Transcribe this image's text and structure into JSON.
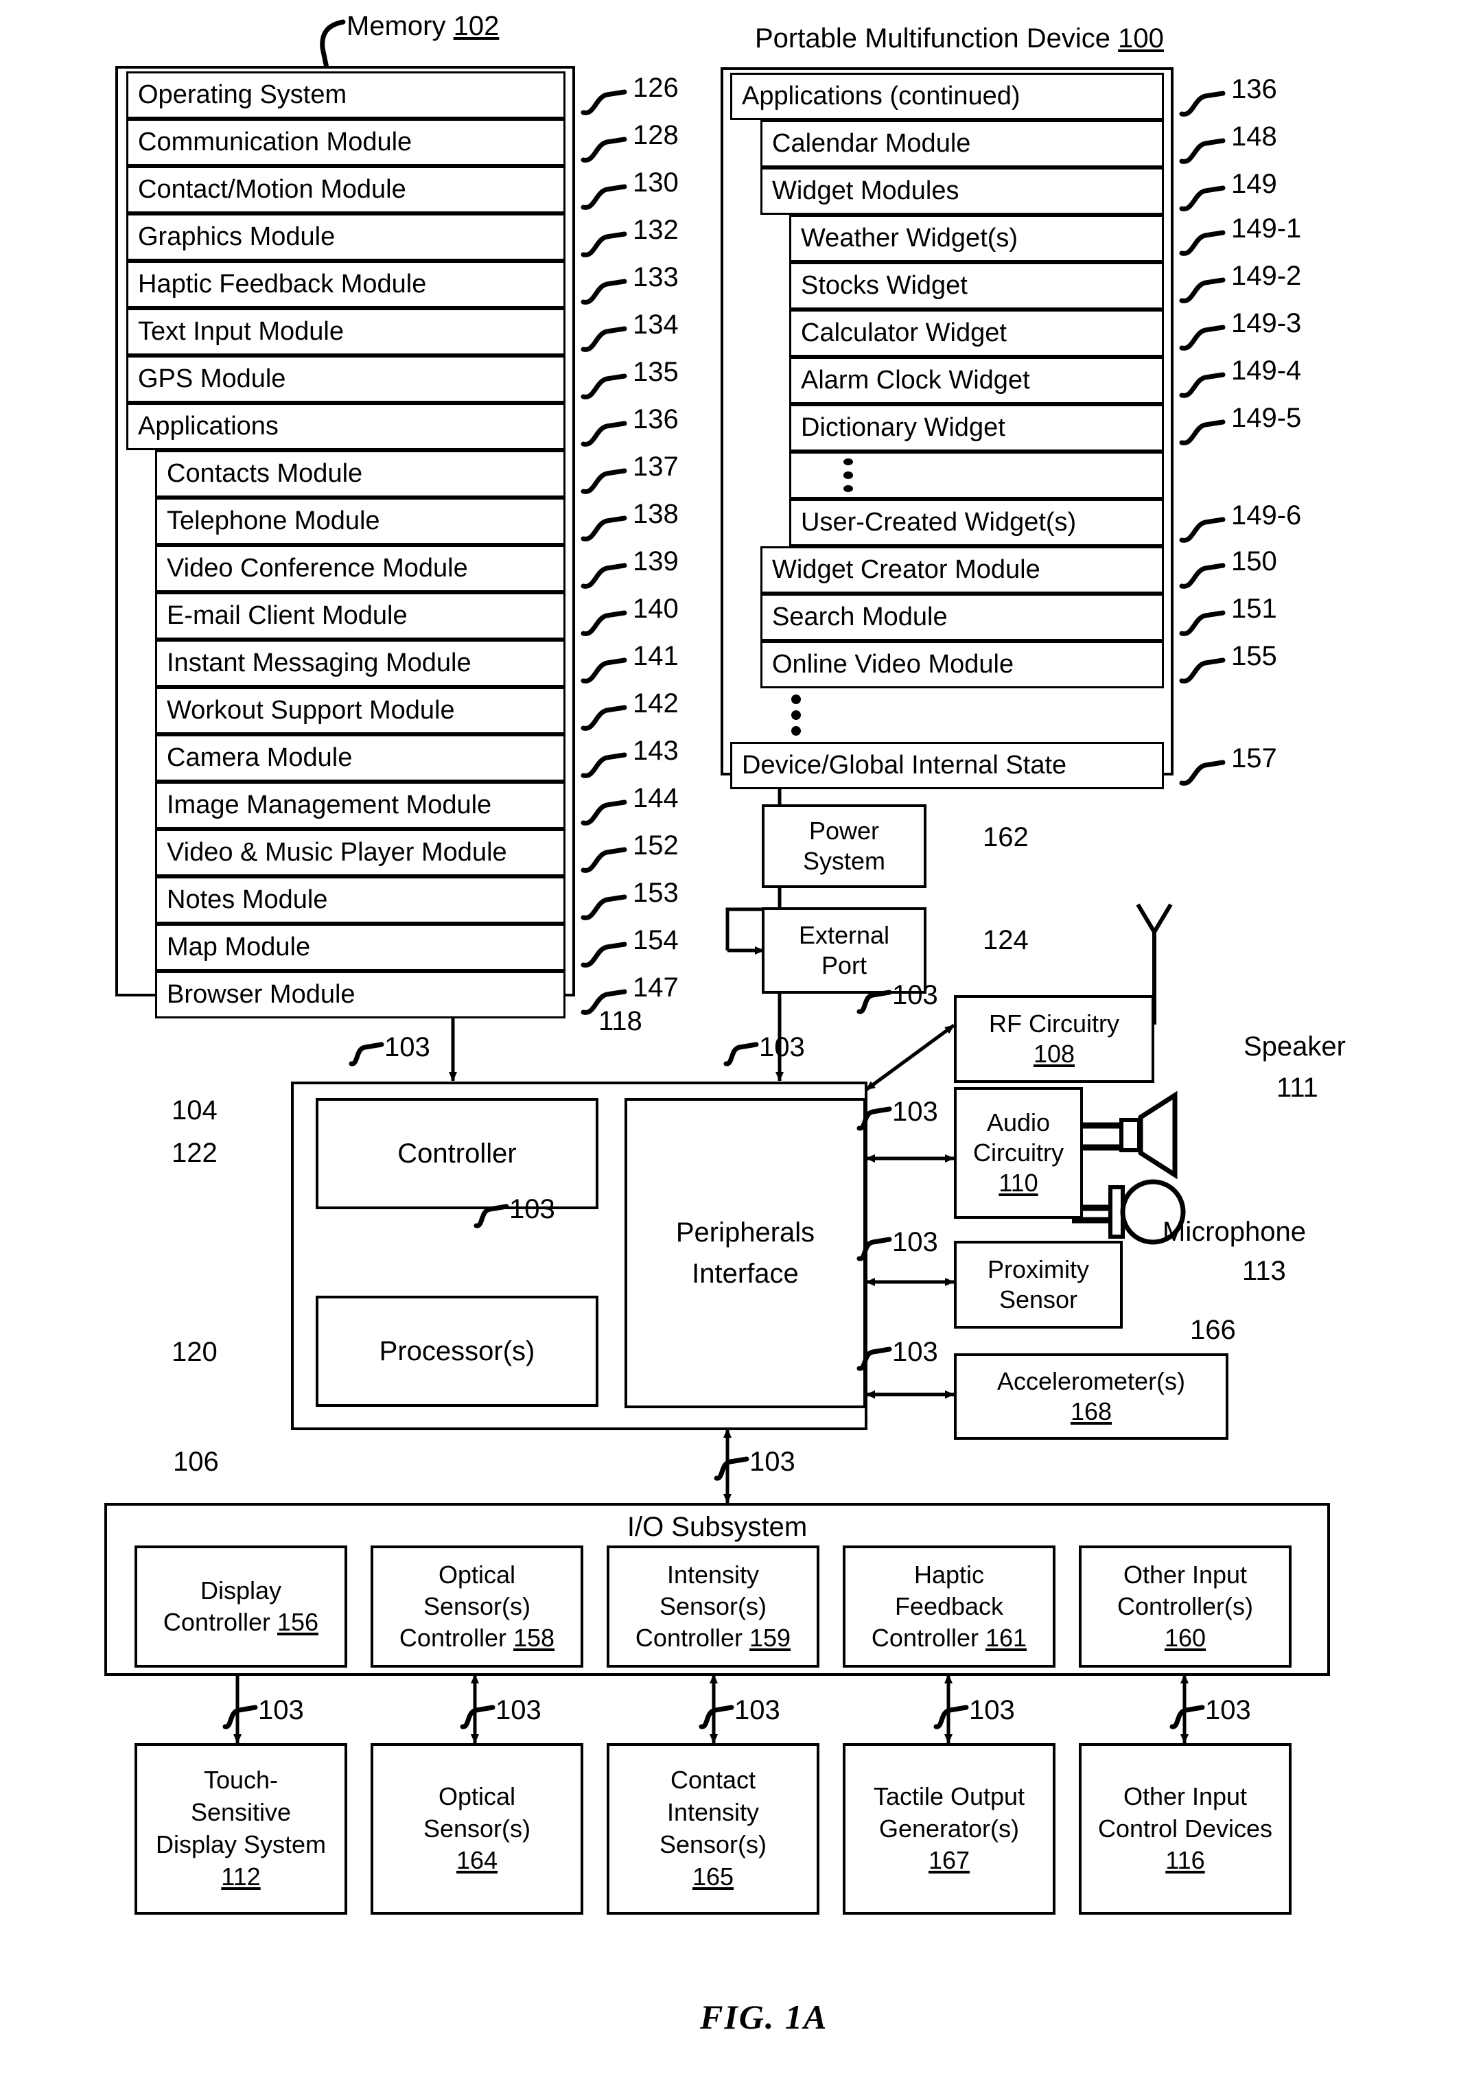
{
  "figure": {
    "caption": "FIG. 1A"
  },
  "memory": {
    "title": "Memory",
    "ref": "102",
    "rows": [
      {
        "label": "Operating System",
        "ref": "126"
      },
      {
        "label": "Communication Module",
        "ref": "128"
      },
      {
        "label": "Contact/Motion Module",
        "ref": "130"
      },
      {
        "label": "Graphics Module",
        "ref": "132"
      },
      {
        "label": "Haptic Feedback Module",
        "ref": "133"
      },
      {
        "label": "Text Input Module",
        "ref": "134"
      },
      {
        "label": "GPS Module",
        "ref": "135"
      },
      {
        "label": "Applications",
        "ref": "136"
      }
    ],
    "applications": [
      {
        "label": "Contacts Module",
        "ref": "137"
      },
      {
        "label": "Telephone Module",
        "ref": "138"
      },
      {
        "label": "Video Conference Module",
        "ref": "139"
      },
      {
        "label": "E-mail Client Module",
        "ref": "140"
      },
      {
        "label": "Instant Messaging Module",
        "ref": "141"
      },
      {
        "label": "Workout Support Module",
        "ref": "142"
      },
      {
        "label": "Camera Module",
        "ref": "143"
      },
      {
        "label": "Image Management Module",
        "ref": "144"
      },
      {
        "label": "Video & Music Player Module",
        "ref": "152"
      },
      {
        "label": "Notes Module",
        "ref": "153"
      },
      {
        "label": "Map Module",
        "ref": "154"
      },
      {
        "label": "Browser Module",
        "ref": "147"
      }
    ]
  },
  "device": {
    "title": "Portable Multifunction Device",
    "ref": "100",
    "applications_continued": {
      "label": "Applications (continued)",
      "ref": "136"
    },
    "calendar": {
      "label": "Calendar Module",
      "ref": "148"
    },
    "widget_modules": {
      "label": "Widget Modules",
      "ref": "149"
    },
    "widgets": [
      {
        "label": "Weather Widget(s)",
        "ref": "149-1"
      },
      {
        "label": "Stocks Widget",
        "ref": "149-2"
      },
      {
        "label": "Calculator Widget",
        "ref": "149-3"
      },
      {
        "label": "Alarm Clock Widget",
        "ref": "149-4"
      },
      {
        "label": "Dictionary Widget",
        "ref": "149-5"
      }
    ],
    "user_created_widget": {
      "label": "User-Created Widget(s)",
      "ref": "149-6"
    },
    "trailing": [
      {
        "label": "Widget Creator Module",
        "ref": "150"
      },
      {
        "label": "Search Module",
        "ref": "151"
      },
      {
        "label": "Online Video Module",
        "ref": "155"
      }
    ],
    "device_state": {
      "label": "Device/Global Internal State",
      "ref": "157"
    }
  },
  "blocks": {
    "power_system": {
      "line1": "Power",
      "line2": "System",
      "ref": "162"
    },
    "external_port": {
      "line1": "External",
      "line2": "Port",
      "ref": "124"
    },
    "rf_circuitry": {
      "line1": "RF Circuitry",
      "ref": "108"
    },
    "audio_circuitry": {
      "line1": "Audio",
      "line2": "Circuitry",
      "ref": "110"
    },
    "proximity_sensor": {
      "line1": "Proximity",
      "line2": "Sensor",
      "ref": "166"
    },
    "accelerometers": {
      "line1": "Accelerometer(s)",
      "ref": "168"
    },
    "controller": {
      "label": "Controller",
      "ref": "122"
    },
    "processors": {
      "label": "Processor(s)",
      "ref": "120"
    },
    "peripherals_interface": {
      "line1": "Peripherals",
      "line2": "Interface",
      "ref": "118"
    },
    "cpu_group_ref": "104",
    "speaker": {
      "label": "Speaker",
      "ref": "111"
    },
    "microphone": {
      "label": "Microphone",
      "ref": "113"
    }
  },
  "io_subsystem": {
    "title": "I/O Subsystem",
    "ref": "106",
    "controllers": [
      {
        "line1": "Display",
        "line2": "Controller",
        "ref": "156"
      },
      {
        "line1": "Optical",
        "line2": "Sensor(s)",
        "line3": "Controller",
        "ref": "158"
      },
      {
        "line1": "Intensity",
        "line2": "Sensor(s)",
        "line3": "Controller",
        "ref": "159"
      },
      {
        "line1": "Haptic",
        "line2": "Feedback",
        "line3": "Controller",
        "ref": "161"
      },
      {
        "line1": "Other Input",
        "line2": "Controller(s)",
        "ref": "160"
      }
    ],
    "devices": [
      {
        "line1": "Touch-",
        "line2": "Sensitive",
        "line3": "Display System",
        "ref": "112"
      },
      {
        "line1": "Optical",
        "line2": "Sensor(s)",
        "ref": "164"
      },
      {
        "line1": "Contact",
        "line2": "Intensity",
        "line3": "Sensor(s)",
        "ref": "165"
      },
      {
        "line1": "Tactile Output",
        "line2": "Generator(s)",
        "ref": "167"
      },
      {
        "line1": "Other Input",
        "line2": "Control Devices",
        "ref": "116"
      }
    ]
  },
  "bus_label": "103"
}
